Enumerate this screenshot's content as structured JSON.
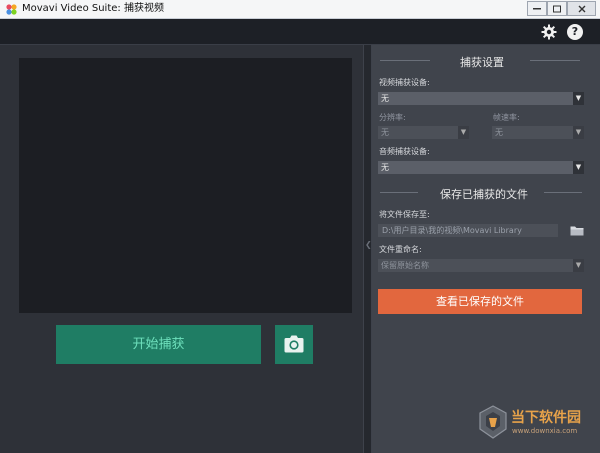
{
  "window": {
    "title": "Movavi Video Suite: 捕获视频"
  },
  "toolbar": {
    "settings_icon": "gear-icon",
    "help_label": "?"
  },
  "capture": {
    "start_label": "开始捕获",
    "snapshot_icon": "camera-icon"
  },
  "settings": {
    "section_title": "捕获设置",
    "video_device_label": "视频捕获设备:",
    "video_device_value": "无",
    "resolution_label": "分辨率:",
    "resolution_value": "无",
    "framerate_label": "帧速率:",
    "framerate_value": "无",
    "audio_device_label": "音频捕获设备:",
    "audio_device_value": "无"
  },
  "save": {
    "section_title": "保存已捕获的文件",
    "save_to_label": "将文件保存至:",
    "save_path": "D:\\用户目录\\我的视频\\Movavi Library",
    "folder_icon": "folder-icon",
    "rename_label": "文件重命名:",
    "rename_value": "保留原始名称",
    "view_saved_label": "查看已保存的文件"
  },
  "watermark": {
    "title": "当下软件园",
    "url": "www.downxia.com"
  },
  "colors": {
    "accent_green": "#1f7d64",
    "accent_orange": "#e2673e",
    "panel_dark": "#2e3138",
    "panel_right": "#40444c"
  }
}
